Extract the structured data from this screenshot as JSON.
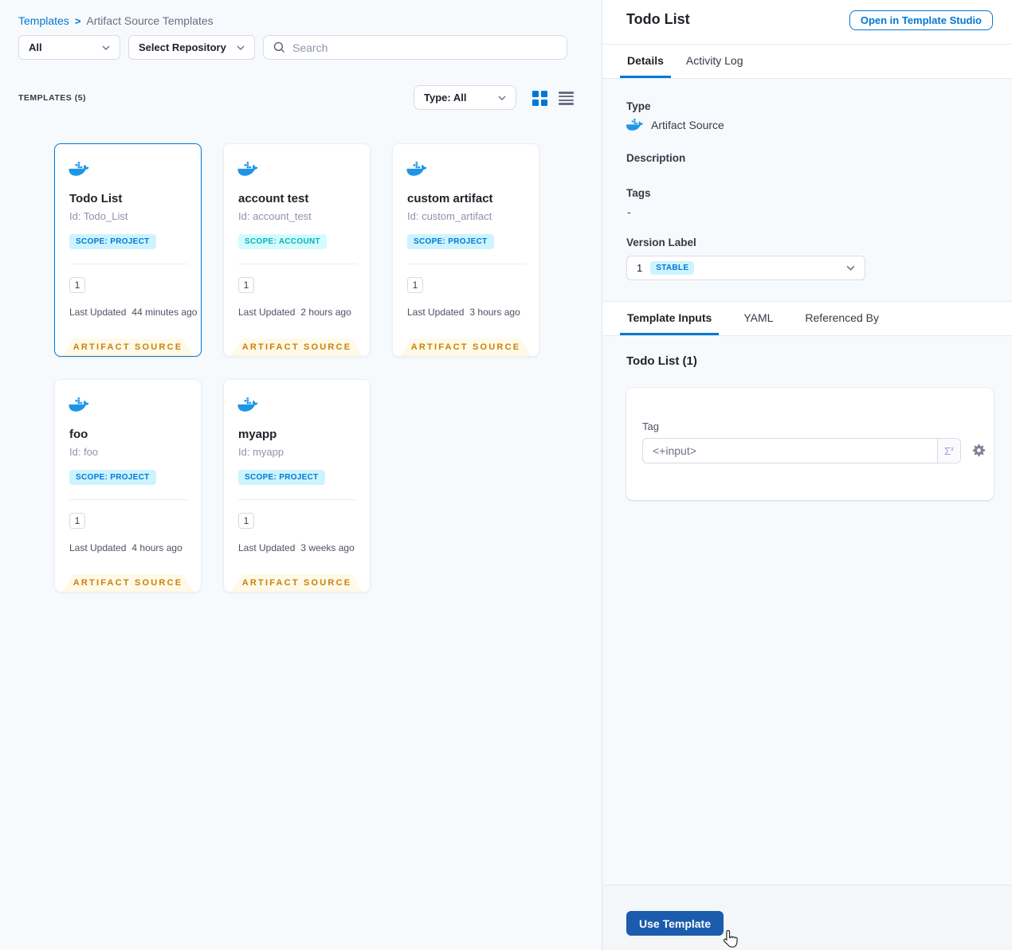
{
  "colors": {
    "accent": "#0278d5",
    "docker": "#1e96e8",
    "scope_project_bg": "#cdf4fe",
    "scope_project_text": "#0278d5",
    "scope_account_bg": "#d4fcfd",
    "scope_account_text": "#0bb1bf",
    "ribbon_bg": "#fff9e7",
    "ribbon_text": "#c8820c",
    "stable_badge_bg": "#cdf4fe",
    "stable_badge_text": "#0278d5",
    "primary_button_bg": "#1b5cac"
  },
  "breadcrumb": {
    "templates": "Templates",
    "separator": ">",
    "current": "Artifact Source Templates"
  },
  "filters": {
    "scope_dropdown": "All",
    "repository_dropdown": "Select Repository",
    "search_placeholder": "Search"
  },
  "list_header": {
    "count_label": "TEMPLATES (5)",
    "type_dropdown": "Type: All"
  },
  "shared": {
    "last_updated_label": "Last Updated",
    "ribbon": "ARTIFACT SOURCE"
  },
  "cards": [
    {
      "title": "Todo List",
      "id": "Id: Todo_List",
      "scope": "SCOPE: PROJECT",
      "version": "1",
      "last_updated": "44 minutes ago",
      "selected": true
    },
    {
      "title": "account test",
      "id": "Id: account_test",
      "scope": "SCOPE: ACCOUNT",
      "version": "1",
      "last_updated": "2 hours ago",
      "selected": false
    },
    {
      "title": "custom artifact",
      "id": "Id: custom_artifact",
      "scope": "SCOPE: PROJECT",
      "version": "1",
      "last_updated": "3 hours ago",
      "selected": false
    },
    {
      "title": "foo",
      "id": "Id: foo",
      "scope": "SCOPE: PROJECT",
      "version": "1",
      "last_updated": "4 hours ago",
      "selected": false
    },
    {
      "title": "myapp",
      "id": "Id: myapp",
      "scope": "SCOPE: PROJECT",
      "version": "1",
      "last_updated": "3 weeks ago",
      "selected": false
    }
  ],
  "details_panel": {
    "title": "Todo List",
    "open_studio_button": "Open in Template Studio",
    "tabs": [
      "Details",
      "Activity Log"
    ],
    "type_label": "Type",
    "type_value": "Artifact Source",
    "description_label": "Description",
    "tags_label": "Tags",
    "tags_value": "-",
    "version_label": "Version Label",
    "version_value": "1",
    "version_badge": "STABLE",
    "inputs_tabs": [
      "Template Inputs",
      "YAML",
      "Referenced By"
    ],
    "inputs_heading": "Todo List (1)",
    "tag_label": "Tag",
    "tag_value": "<+input>",
    "expression_button": "Σ",
    "expression_button_sup": "x",
    "use_template_button": "Use Template"
  },
  "icons": {
    "docker-icon": "docker whale",
    "search-icon": "magnifier",
    "chevron-down-icon": "v",
    "grid-view-icon": "four squares",
    "list-view-icon": "four bars",
    "gear-icon": "settings gear",
    "expression-icon": "sigma-x",
    "cursor-pointer": "hand pointer"
  }
}
